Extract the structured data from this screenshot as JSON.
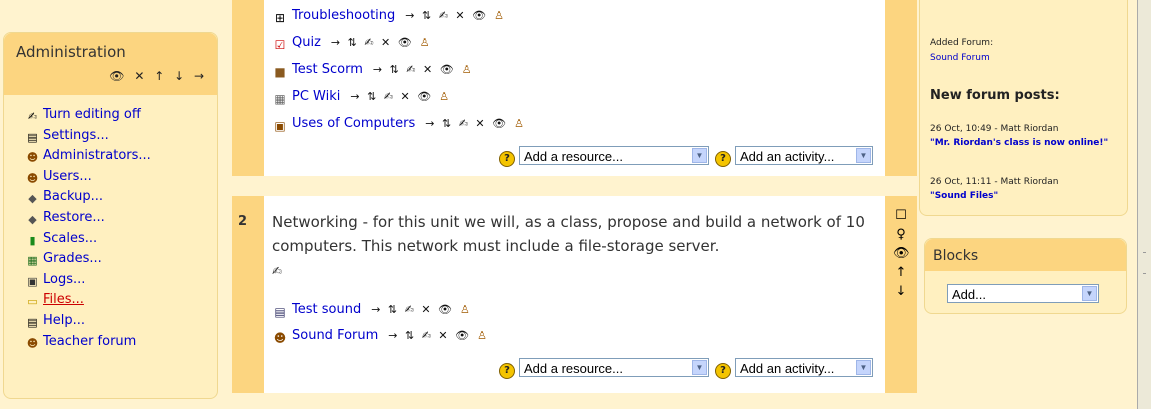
{
  "admin": {
    "title": "Administration",
    "header_controls": "👁 ✕ ↑ ↓ →",
    "items": [
      {
        "label": "Turn editing off",
        "icon": "✍"
      },
      {
        "label": "Settings...",
        "icon": "▤"
      },
      {
        "label": "Administrators...",
        "icon": "☻"
      },
      {
        "label": "Users...",
        "icon": "☻"
      },
      {
        "label": "Backup...",
        "icon": "◆"
      },
      {
        "label": "Restore...",
        "icon": "◆"
      },
      {
        "label": "Scales...",
        "icon": "▮"
      },
      {
        "label": "Grades...",
        "icon": "▦"
      },
      {
        "label": "Logs...",
        "icon": "▣"
      },
      {
        "label": "Files...",
        "icon": "▭"
      },
      {
        "label": "Help...",
        "icon": "▤"
      },
      {
        "label": "Teacher forum",
        "icon": "☻"
      }
    ]
  },
  "section1": {
    "activities": [
      {
        "label": "Troubleshooting",
        "icon": "⊞"
      },
      {
        "label": "Quiz",
        "icon": "☑"
      },
      {
        "label": "Test Scorm",
        "icon": "■"
      },
      {
        "label": "PC Wiki",
        "icon": "▦"
      },
      {
        "label": "Uses of Computers",
        "icon": "▣"
      }
    ],
    "add_resource": "Add a resource...",
    "add_activity": "Add an activity..."
  },
  "section2": {
    "number": "2",
    "summary": "Networking - for this unit we will, as a class, propose and build a network of 10 computers. This network must include a file-storage server.",
    "edit_icon": "✍",
    "right_controls": [
      "☐",
      "♀",
      "👁",
      "↑",
      "↓"
    ],
    "activities": [
      {
        "label": "Test sound",
        "icon": "▤"
      },
      {
        "label": "Sound Forum",
        "icon": "☻"
      }
    ],
    "add_resource": "Add a resource...",
    "add_activity": "Add an activity..."
  },
  "activity_controls": "→ ⇅ ✍ ✕ 👁",
  "activity_person": "♙",
  "help_glyph": "?",
  "right": {
    "added_label": "Added Forum:",
    "added_link": "Sound Forum",
    "new_posts_title": "New forum posts:",
    "posts": [
      {
        "meta": "26 Oct, 10:49 - Matt Riordan",
        "title": "\"Mr. Riordan's class is now online!\""
      },
      {
        "meta": "26 Oct, 11:11 - Matt Riordan",
        "title": "\"Sound Files\""
      }
    ]
  },
  "blocks": {
    "title": "Blocks",
    "add_select": "Add..."
  }
}
